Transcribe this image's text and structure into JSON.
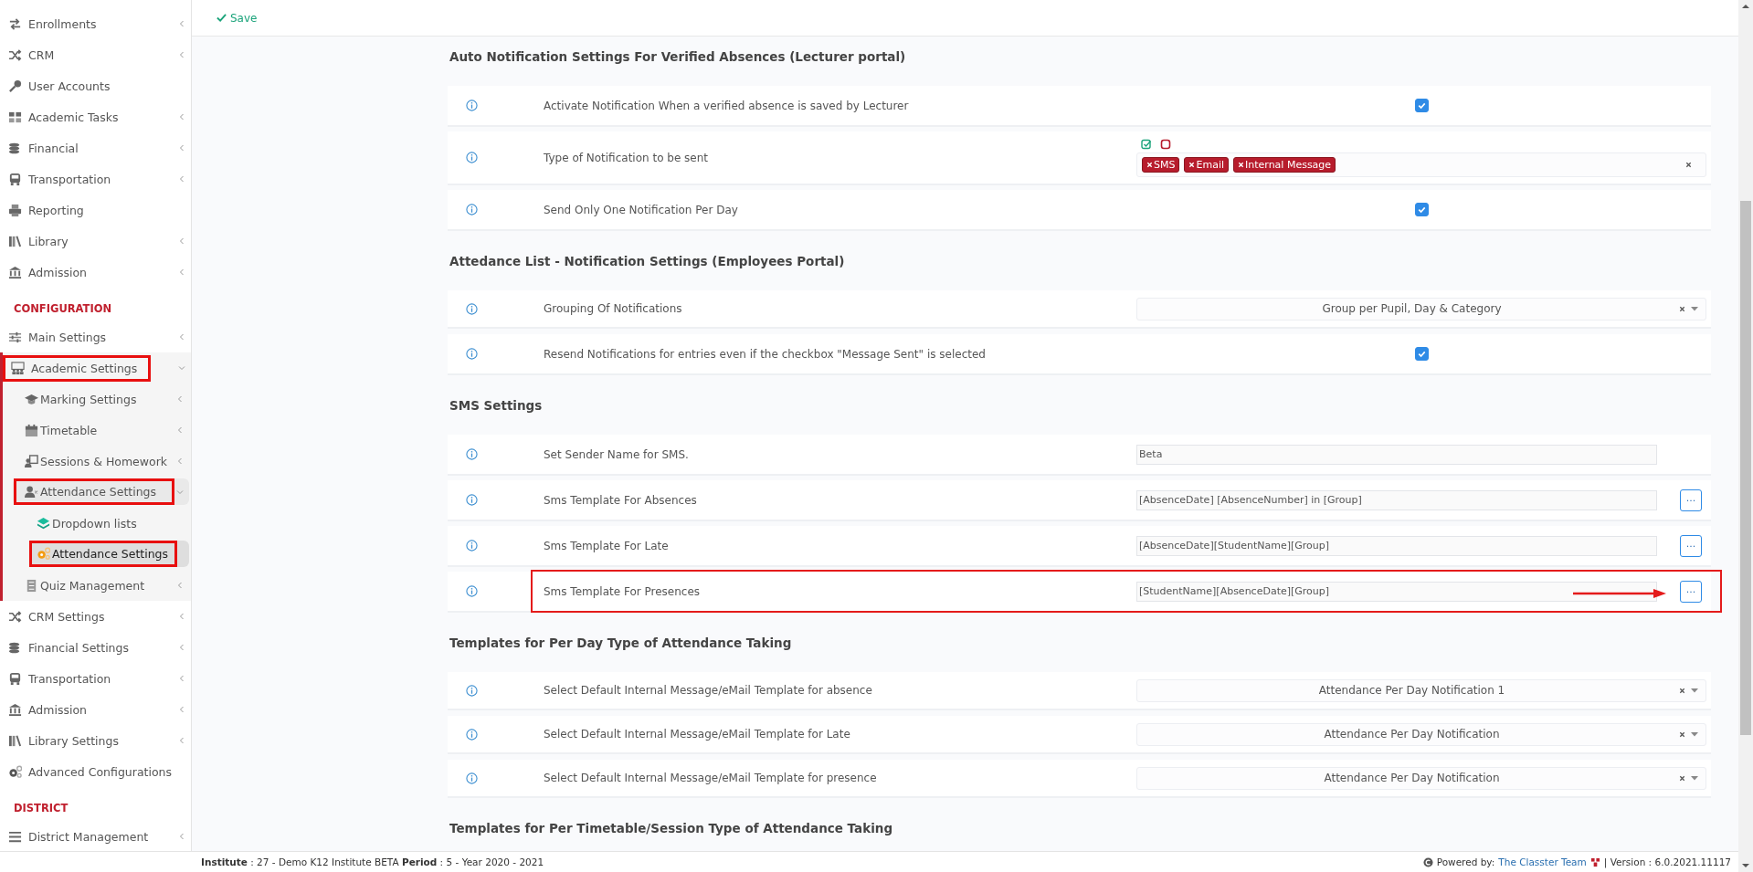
{
  "toolbar": {
    "save_label": "Save"
  },
  "sidebar": {
    "items": [
      {
        "kind": "link",
        "label": "Enrollments",
        "has_submenu": true,
        "expanded": false,
        "selected": false,
        "highlighted": false
      },
      {
        "kind": "link",
        "label": "CRM",
        "has_submenu": true,
        "expanded": false,
        "selected": false,
        "highlighted": false
      },
      {
        "kind": "link",
        "label": "User Accounts",
        "has_submenu": false,
        "selected": false,
        "highlighted": false
      },
      {
        "kind": "link",
        "label": "Academic Tasks",
        "has_submenu": true,
        "expanded": false,
        "selected": false,
        "highlighted": false
      },
      {
        "kind": "link",
        "label": "Financial",
        "has_submenu": true,
        "expanded": false,
        "selected": false,
        "highlighted": false
      },
      {
        "kind": "link",
        "label": "Transportation",
        "has_submenu": true,
        "expanded": false,
        "selected": false,
        "highlighted": false
      },
      {
        "kind": "link",
        "label": "Reporting",
        "has_submenu": false,
        "selected": false,
        "highlighted": false
      },
      {
        "kind": "link",
        "label": "Library",
        "has_submenu": true,
        "expanded": false,
        "selected": false,
        "highlighted": false
      },
      {
        "kind": "link",
        "label": "Admission",
        "has_submenu": true,
        "expanded": false,
        "selected": false,
        "highlighted": false
      },
      {
        "kind": "header",
        "label": "CONFIGURATION"
      },
      {
        "kind": "link",
        "label": "Main Settings",
        "has_submenu": true,
        "expanded": false,
        "selected": false,
        "highlighted": false
      },
      {
        "kind": "link",
        "label": "Academic Settings",
        "has_submenu": true,
        "expanded": true,
        "selected": false,
        "highlighted": true,
        "children": [
          {
            "kind": "link",
            "label": "Marking Settings",
            "has_submenu": true,
            "expanded": false,
            "selected": false,
            "highlighted": false
          },
          {
            "kind": "link",
            "label": "Timetable",
            "has_submenu": true,
            "expanded": false,
            "selected": false,
            "highlighted": false
          },
          {
            "kind": "link",
            "label": "Sessions & Homework",
            "has_submenu": true,
            "expanded": false,
            "selected": false,
            "highlighted": false
          },
          {
            "kind": "link",
            "label": "Attendance Settings",
            "has_submenu": true,
            "expanded": true,
            "selected": false,
            "highlighted": true,
            "children": [
              {
                "kind": "link",
                "label": "Dropdown lists",
                "has_submenu": false,
                "selected": false,
                "highlighted": false
              },
              {
                "kind": "link",
                "label": "Attendance Settings",
                "has_submenu": false,
                "selected": true,
                "highlighted": true
              }
            ]
          },
          {
            "kind": "link",
            "label": "Quiz Management",
            "has_submenu": true,
            "expanded": false,
            "selected": false,
            "highlighted": false
          }
        ]
      },
      {
        "kind": "link",
        "label": "CRM Settings",
        "has_submenu": true,
        "expanded": false,
        "selected": false,
        "highlighted": false
      },
      {
        "kind": "link",
        "label": "Financial Settings",
        "has_submenu": true,
        "expanded": false,
        "selected": false,
        "highlighted": false
      },
      {
        "kind": "link",
        "label": "Transportation",
        "has_submenu": true,
        "expanded": false,
        "selected": false,
        "highlighted": false
      },
      {
        "kind": "link",
        "label": "Admission",
        "has_submenu": true,
        "expanded": false,
        "selected": false,
        "highlighted": false
      },
      {
        "kind": "link",
        "label": "Library Settings",
        "has_submenu": true,
        "expanded": false,
        "selected": false,
        "highlighted": false
      },
      {
        "kind": "link",
        "label": "Advanced Configurations",
        "has_submenu": false,
        "selected": false,
        "highlighted": false
      },
      {
        "kind": "header",
        "label": "DISTRICT"
      },
      {
        "kind": "link",
        "label": "District Management",
        "has_submenu": true,
        "expanded": false,
        "selected": false,
        "highlighted": false
      }
    ]
  },
  "sections": [
    {
      "title": "Auto Notification Settings For Verified Absences (Lecturer portal)",
      "rows": [
        {
          "kind": "checkbox",
          "label": "Activate Notification When a verified absence is saved by Lecturer",
          "checked": true
        },
        {
          "kind": "tags",
          "label": "Type of Notification to be sent",
          "tags": [
            "SMS",
            "Email",
            "Internal Message"
          ]
        },
        {
          "kind": "checkbox",
          "label": "Send Only One Notification Per Day",
          "checked": true
        }
      ]
    },
    {
      "title": "Attedance List - Notification Settings (Employees Portal)",
      "rows": [
        {
          "kind": "select",
          "label": "Grouping Of Notifications",
          "value": "Group per Pupil, Day & Category"
        },
        {
          "kind": "checkbox",
          "label": "Resend Notifications for entries even if the checkbox \"Message Sent\" is selected",
          "checked": true
        }
      ]
    },
    {
      "title": "SMS Settings",
      "rows": [
        {
          "kind": "text",
          "label": "Set Sender Name for SMS.",
          "value": "Beta"
        },
        {
          "kind": "template",
          "label": "Sms Template For Absences",
          "value": "[AbsenceDate] [AbsenceNumber] in [Group]",
          "button_label": "...",
          "highlighted": false
        },
        {
          "kind": "template",
          "label": "Sms Template For Late",
          "value": "[AbsenceDate][StudentName][Group]",
          "button_label": "...",
          "highlighted": false
        },
        {
          "kind": "template",
          "label": "Sms Template For Presences",
          "value": "[StudentName][AbsenceDate][Group]",
          "button_label": "...",
          "highlighted": true
        }
      ]
    },
    {
      "title": "Templates for Per Day Type of Attendance Taking",
      "rows": [
        {
          "kind": "select",
          "label": "Select Default Internal Message/eMail Template for absence",
          "value": "Attendance Per Day Notification 1"
        },
        {
          "kind": "select",
          "label": "Select Default Internal Message/eMail Template for Late",
          "value": "Attendance Per Day Notification"
        },
        {
          "kind": "select",
          "label": "Select Default Internal Message/eMail Template for presence",
          "value": "Attendance Per Day Notification"
        }
      ]
    },
    {
      "title": "Templates for Per Timetable/Session Type of Attendance Taking"
    }
  ],
  "footer": {
    "institute": "**Institute** : 27 - Demo K12 Institute BETA **Period** : 5 - Year 2020 - 2021",
    "powered_by": "Powered by:",
    "team_link": "The Classter Team",
    "version": "| Version : 6.0.2021.11117"
  }
}
